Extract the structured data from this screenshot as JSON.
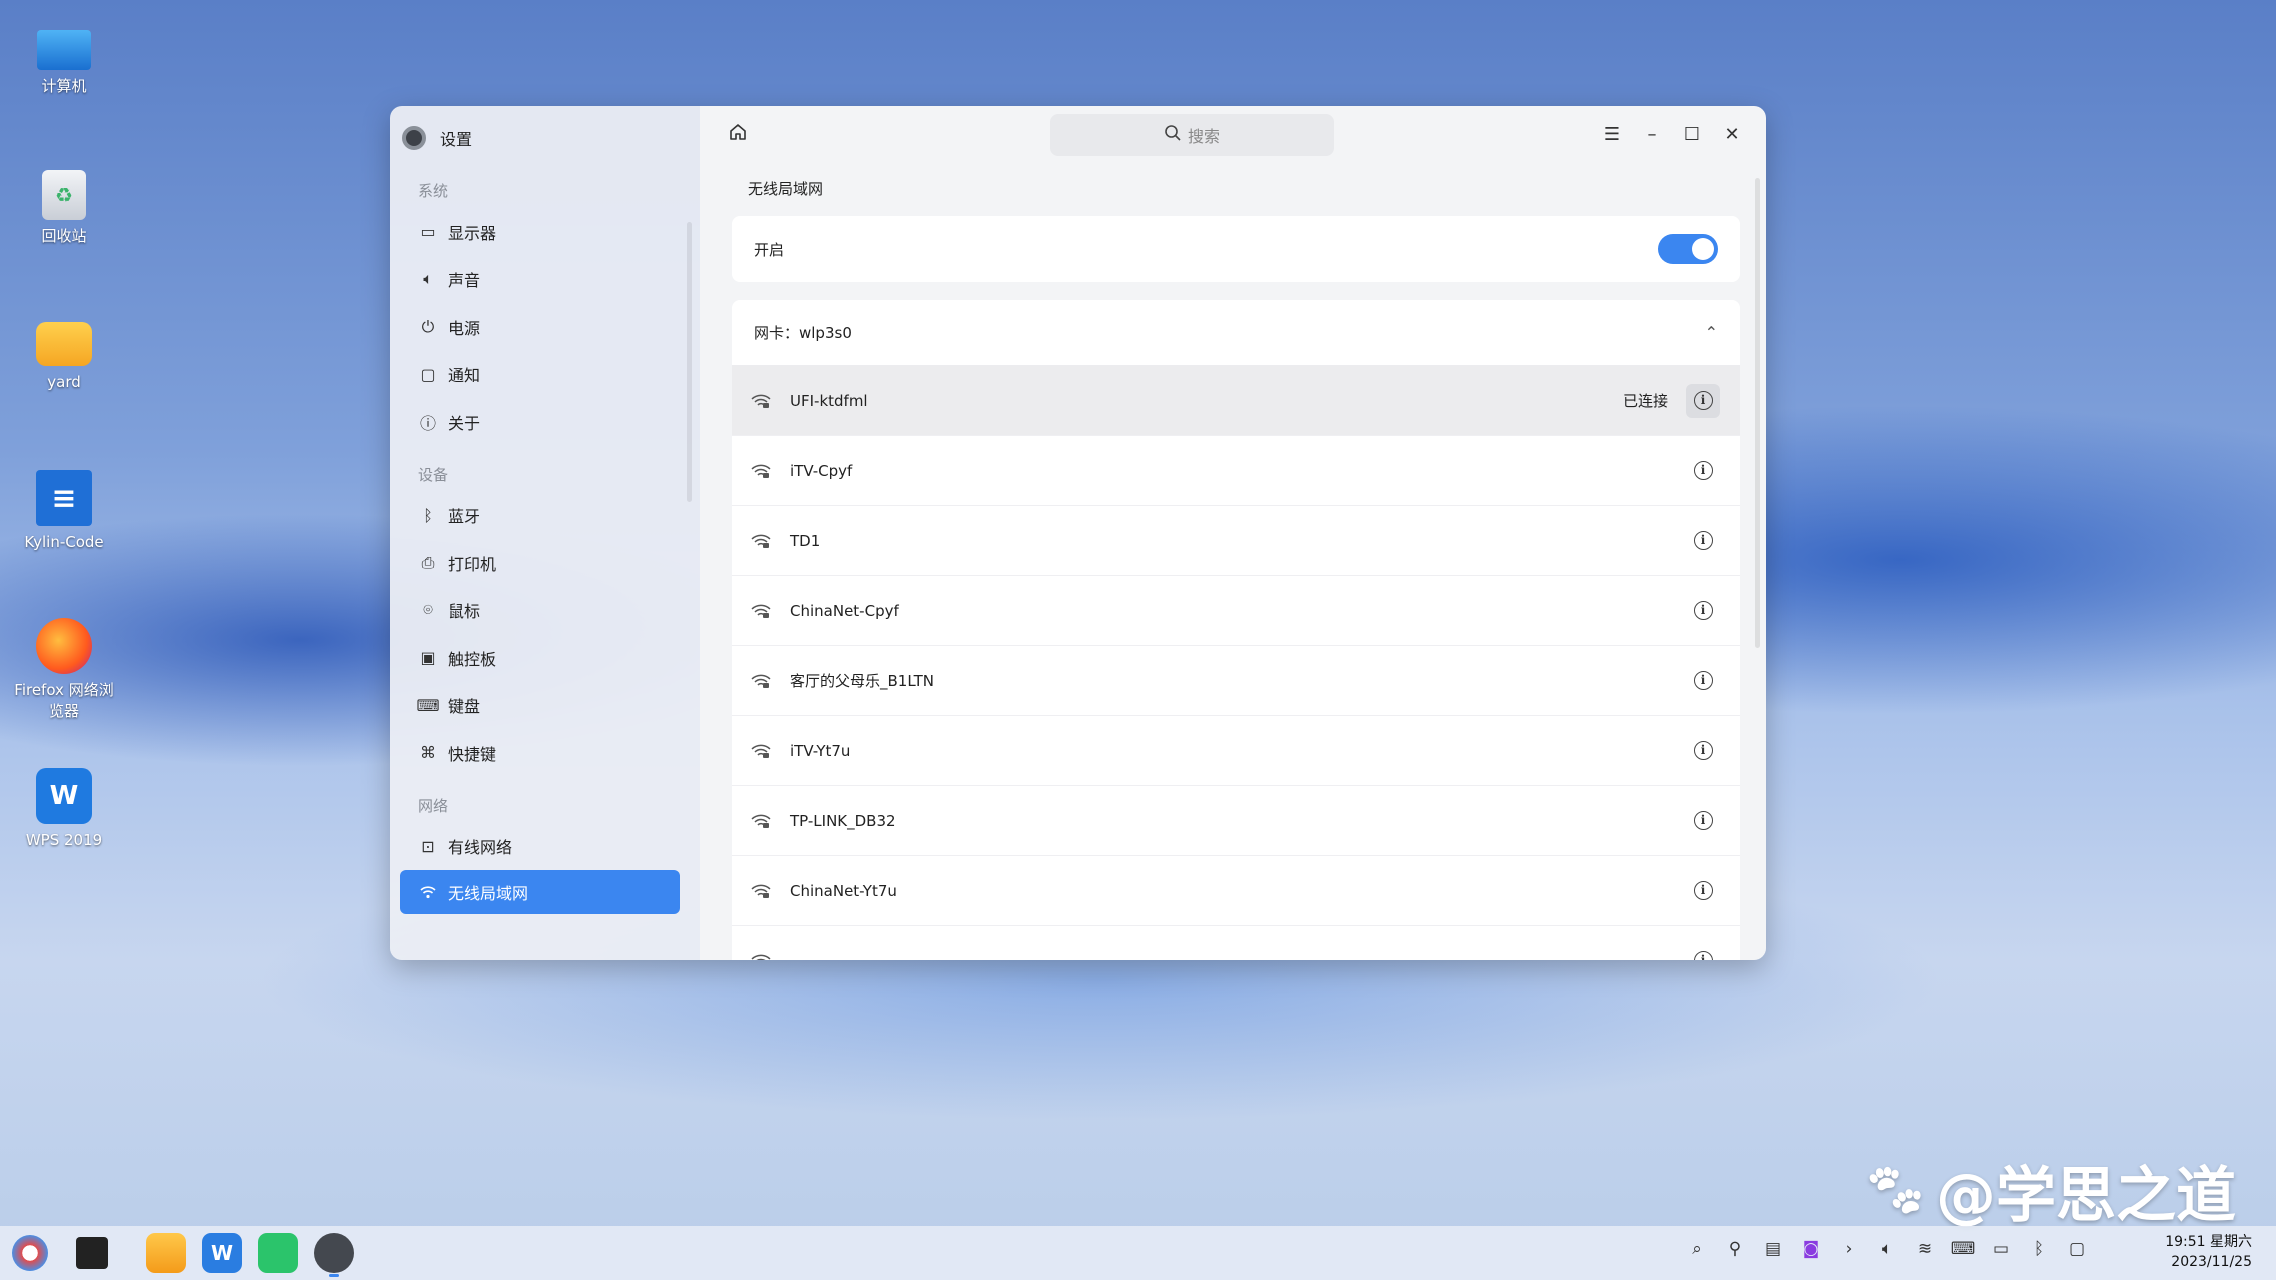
{
  "desktop": {
    "icons": [
      {
        "label": "计算机",
        "icon": "computer-icon"
      },
      {
        "label": "回收站",
        "icon": "trash-icon"
      },
      {
        "label": "yard",
        "icon": "folder-icon"
      },
      {
        "label": "Kylin-Code",
        "icon": "code-editor-icon"
      },
      {
        "label": "Firefox 网络浏览器",
        "icon": "firefox-icon"
      },
      {
        "label": "WPS 2019",
        "icon": "wps-icon"
      }
    ]
  },
  "window": {
    "app_title": "设置",
    "search_placeholder": "搜索",
    "sidebar": {
      "groups": [
        {
          "label": "系统",
          "items": [
            {
              "label": "显示器",
              "icon": "monitor-icon"
            },
            {
              "label": "声音",
              "icon": "speaker-icon"
            },
            {
              "label": "电源",
              "icon": "power-icon"
            },
            {
              "label": "通知",
              "icon": "notification-icon"
            },
            {
              "label": "关于",
              "icon": "about-icon"
            }
          ]
        },
        {
          "label": "设备",
          "items": [
            {
              "label": "蓝牙",
              "icon": "bluetooth-icon"
            },
            {
              "label": "打印机",
              "icon": "printer-icon"
            },
            {
              "label": "鼠标",
              "icon": "mouse-icon"
            },
            {
              "label": "触控板",
              "icon": "touchpad-icon"
            },
            {
              "label": "键盘",
              "icon": "keyboard-icon"
            },
            {
              "label": "快捷键",
              "icon": "shortcut-icon"
            }
          ]
        },
        {
          "label": "网络",
          "items": [
            {
              "label": "有线网络",
              "icon": "wired-network-icon"
            },
            {
              "label": "无线局域网",
              "icon": "wifi-icon",
              "active": true
            }
          ]
        }
      ]
    },
    "main": {
      "section_title": "无线局域网",
      "enable_label": "开启",
      "enabled": true,
      "nic_label": "网卡：wlp3s0",
      "networks": [
        {
          "name": "UFI-ktdfml",
          "status": "已连接"
        },
        {
          "name": "iTV-Cpyf",
          "status": ""
        },
        {
          "name": "TD1",
          "status": ""
        },
        {
          "name": "ChinaNet-Cpyf",
          "status": ""
        },
        {
          "name": "客厅的父母乐_B1LTN",
          "status": ""
        },
        {
          "name": "iTV-Yt7u",
          "status": ""
        },
        {
          "name": "TP-LINK_DB32",
          "status": ""
        },
        {
          "name": "ChinaNet-Yt7u",
          "status": ""
        },
        {
          "name": "",
          "status": ""
        }
      ]
    }
  },
  "taskbar": {
    "clock_time": "19:51 星期六",
    "clock_date": "2023/11/25"
  },
  "watermark": "@学思之道",
  "colors": {
    "accent": "#3b86f0"
  }
}
